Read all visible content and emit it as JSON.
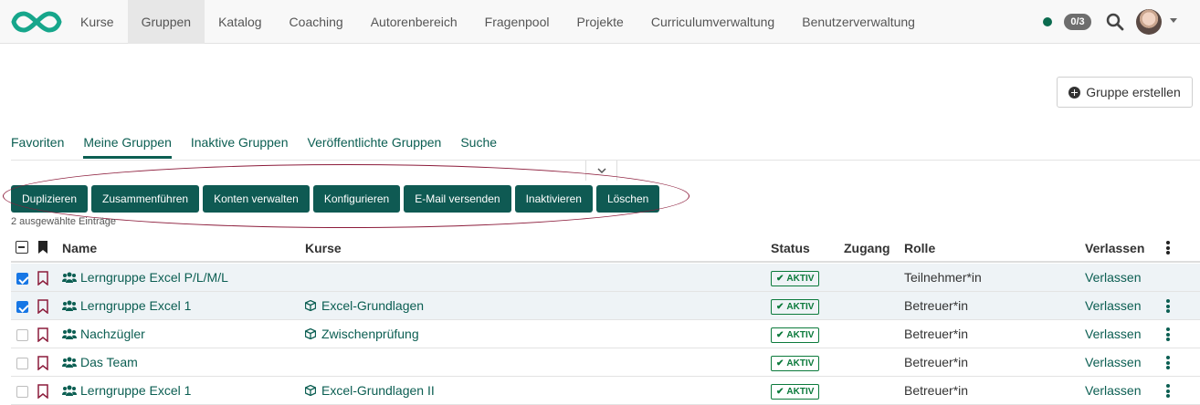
{
  "nav": {
    "items": [
      {
        "label": "Kurse",
        "active": false
      },
      {
        "label": "Gruppen",
        "active": true
      },
      {
        "label": "Katalog",
        "active": false
      },
      {
        "label": "Coaching",
        "active": false
      },
      {
        "label": "Autorenbereich",
        "active": false
      },
      {
        "label": "Fragenpool",
        "active": false
      },
      {
        "label": "Projekte",
        "active": false
      },
      {
        "label": "Curriculumverwaltung",
        "active": false
      },
      {
        "label": "Benutzerverwaltung",
        "active": false
      }
    ],
    "count_badge": "0/3",
    "status_color": "#0b6b4f"
  },
  "create_button": "Gruppe erstellen",
  "tabs": [
    {
      "label": "Favoriten",
      "active": false
    },
    {
      "label": "Meine Gruppen",
      "active": true
    },
    {
      "label": "Inaktive Gruppen",
      "active": false
    },
    {
      "label": "Veröffentlichte Gruppen",
      "active": false
    },
    {
      "label": "Suche",
      "active": false
    }
  ],
  "bulk_actions": [
    "Duplizieren",
    "Zusammenführen",
    "Konten verwalten",
    "Konfigurieren",
    "E-Mail versenden",
    "Inaktivieren",
    "Löschen"
  ],
  "selected_count": "2 ausgewählte Einträge",
  "table": {
    "headers": {
      "name": "Name",
      "kurse": "Kurse",
      "status": "Status",
      "zugang": "Zugang",
      "rolle": "Rolle",
      "verlassen": "Verlassen"
    },
    "rows": [
      {
        "checked": true,
        "name": "Lerngruppe Excel P/L/M/L",
        "kurs": "",
        "status": "AKTIV",
        "rolle": "Teilnehmer*in",
        "verlassen": "Verlassen",
        "menu": false
      },
      {
        "checked": true,
        "name": "Lerngruppe Excel 1",
        "kurs": "Excel-Grundlagen",
        "status": "AKTIV",
        "rolle": "Betreuer*in",
        "verlassen": "Verlassen",
        "menu": true
      },
      {
        "checked": false,
        "name": "Nachzügler",
        "kurs": "Zwischenprüfung",
        "status": "AKTIV",
        "rolle": "Betreuer*in",
        "verlassen": "Verlassen",
        "menu": true
      },
      {
        "checked": false,
        "name": "Das Team",
        "kurs": "",
        "status": "AKTIV",
        "rolle": "Betreuer*in",
        "verlassen": "Verlassen",
        "menu": true
      },
      {
        "checked": false,
        "name": "Lerngruppe Excel 1",
        "kurs": "Excel-Grundlagen II",
        "status": "AKTIV",
        "rolle": "Betreuer*in",
        "verlassen": "Verlassen",
        "menu": true
      }
    ]
  },
  "colors": {
    "brand": "#0b5e52",
    "button_bg": "#0f5a53",
    "highlight": "#8c1c3b",
    "bookmark": "#8c1c3b",
    "active_badge": "#0b7a3b"
  }
}
